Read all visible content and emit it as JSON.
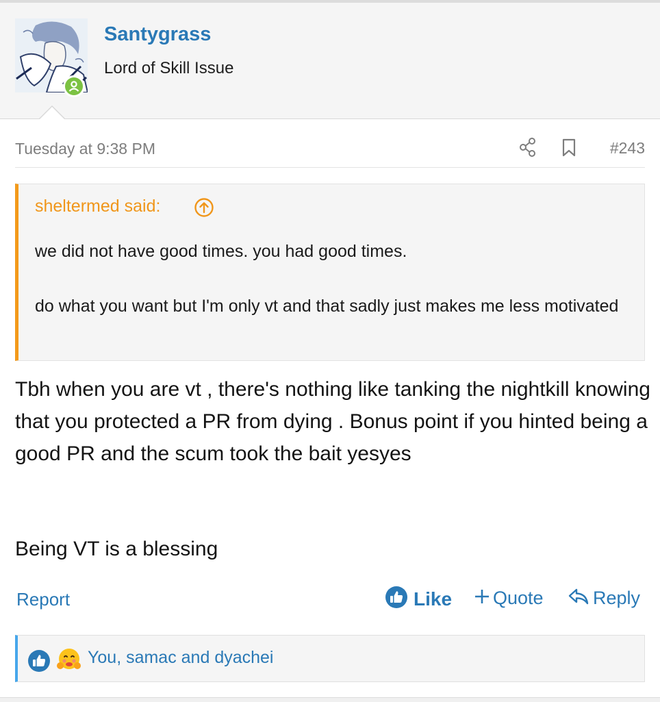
{
  "post": {
    "author": {
      "username": "Santygrass",
      "user_title": "Lord of Skill Issue",
      "online": true
    },
    "meta": {
      "date": "Tuesday at 9:38 PM",
      "post_number": "#243",
      "share_icon": "share-icon",
      "bookmark_icon": "bookmark-icon"
    },
    "quote": {
      "author_label": "sheltermed said:",
      "lines": [
        "we did not have good times. you had good times.",
        "do what you want but I'm only vt and that sadly just makes me less motivated"
      ]
    },
    "message": {
      "paragraph1": "Tbh when you are vt , there's nothing like tanking the nightkill knowing that you protected a PR from dying . Bonus point if you hinted being a good PR and the scum took the bait yesyes",
      "paragraph2": "Being VT is a blessing"
    },
    "actions": {
      "report": "Report",
      "like": "Like",
      "quote": "Quote",
      "reply": "Reply"
    },
    "reactions": {
      "summary": "You, samac and dyachei",
      "icons": [
        "like-reaction-icon",
        "hug-emoji-icon"
      ]
    }
  },
  "colors": {
    "link": "#2a79b6",
    "quote_accent": "#f39a1b",
    "reaction_accent": "#47a7eb",
    "online": "#7cc243"
  }
}
